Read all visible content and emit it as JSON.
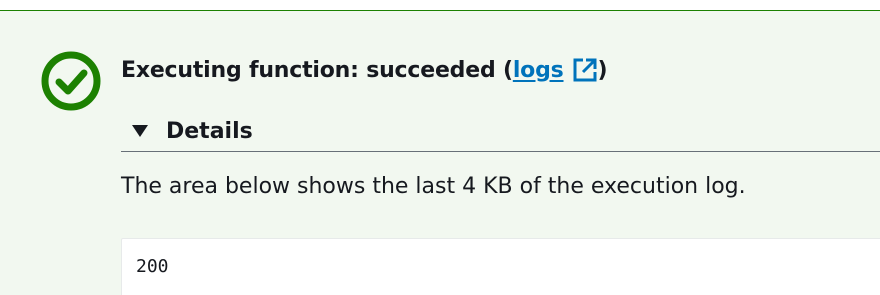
{
  "alert": {
    "status": "success",
    "status_color": "#1d8102",
    "status_icon": "check-circle-icon",
    "title_prefix": "Executing function: succeeded (",
    "logs_link_label": "logs",
    "logs_link_icon": "external-link-icon",
    "title_suffix": ")"
  },
  "details": {
    "label": "Details",
    "expanded": true,
    "toggle_icon": "caret-down-icon",
    "description": "The area below shows the last 4 KB of the execution log.",
    "log_output": "200"
  },
  "colors": {
    "background": "#f2f8f0",
    "accent_green": "#1d8102",
    "link_blue": "#0073bb",
    "text": "#16191f"
  }
}
